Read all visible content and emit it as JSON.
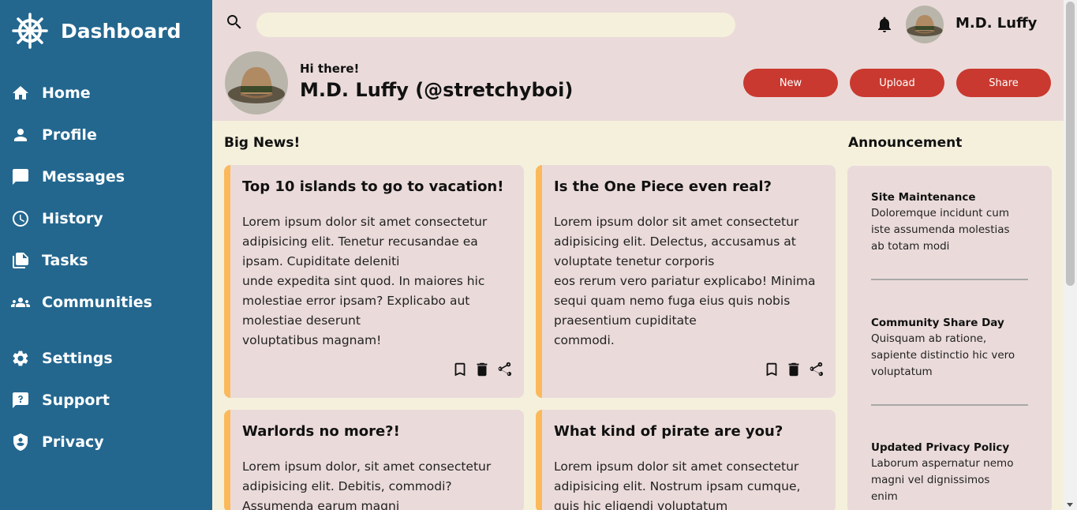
{
  "sidebar": {
    "brand": "Dashboard",
    "items": [
      {
        "label": "Home",
        "icon": "home-icon"
      },
      {
        "label": "Profile",
        "icon": "person-icon"
      },
      {
        "label": "Messages",
        "icon": "chat-icon"
      },
      {
        "label": "History",
        "icon": "clock-icon"
      },
      {
        "label": "Tasks",
        "icon": "documents-icon"
      },
      {
        "label": "Communities",
        "icon": "group-icon"
      },
      {
        "label": "Settings",
        "icon": "gear-icon"
      },
      {
        "label": "Support",
        "icon": "help-bubble-icon"
      },
      {
        "label": "Privacy",
        "icon": "shield-icon"
      }
    ]
  },
  "header": {
    "search_placeholder": "",
    "user_name": "M.D. Luffy",
    "greeting": "Hi there!",
    "handle": "M.D. Luffy (@stretchyboi)",
    "buttons": {
      "new": "New",
      "upload": "Upload",
      "share": "Share"
    }
  },
  "news": {
    "title": "Big News!",
    "cards": [
      {
        "title": "Top 10 islands to go to vacation!",
        "lines": [
          "Lorem ipsum dolor sit amet consectetur",
          "adipisicing elit. Tenetur recusandae ea",
          "ipsam. Cupiditate deleniti",
          "unde expedita sint quod. In maiores hic",
          "molestiae error ipsam? Explicabo aut",
          "molestiae deserunt",
          "voluptatibus magnam!"
        ]
      },
      {
        "title": "Is the One Piece even real?",
        "lines": [
          "Lorem ipsum dolor sit amet consectetur",
          "adipisicing elit. Delectus, accusamus at",
          "voluptate tenetur corporis",
          "eos rerum vero pariatur explicabo! Minima",
          "sequi quam nemo fuga eius quis nobis",
          "praesentium cupiditate",
          "commodi."
        ]
      },
      {
        "title": "Warlords no more?!",
        "lines": [
          "Lorem ipsum dolor, sit amet consectetur",
          "adipisicing elit. Debitis, commodi?",
          "Assumenda earum magni"
        ]
      },
      {
        "title": "What kind of pirate are you?",
        "lines": [
          "Lorem ipsum dolor sit amet consectetur",
          "adipisicing elit. Nostrum ipsam cumque,",
          "quis hic eligendi voluptatum"
        ]
      }
    ]
  },
  "announcements": {
    "title": "Announcement",
    "items": [
      {
        "title": "Site Maintenance",
        "lines": [
          "Doloremque incidunt cum",
          "iste assumenda molestias",
          "ab totam modi"
        ]
      },
      {
        "title": "Community Share Day",
        "lines": [
          "Quisquam ab ratione,",
          "sapiente distinctio hic vero",
          "voluptatum"
        ]
      },
      {
        "title": "Updated Privacy Policy",
        "lines": [
          "Laborum aspernatur nemo",
          "magni vel dignissimos",
          "enim"
        ]
      }
    ]
  },
  "colors": {
    "sidebar": "#23678f",
    "header": "#eadbda",
    "background": "#f5f0dc",
    "button": "#c9392f",
    "card_accent": "#fbb95c"
  }
}
